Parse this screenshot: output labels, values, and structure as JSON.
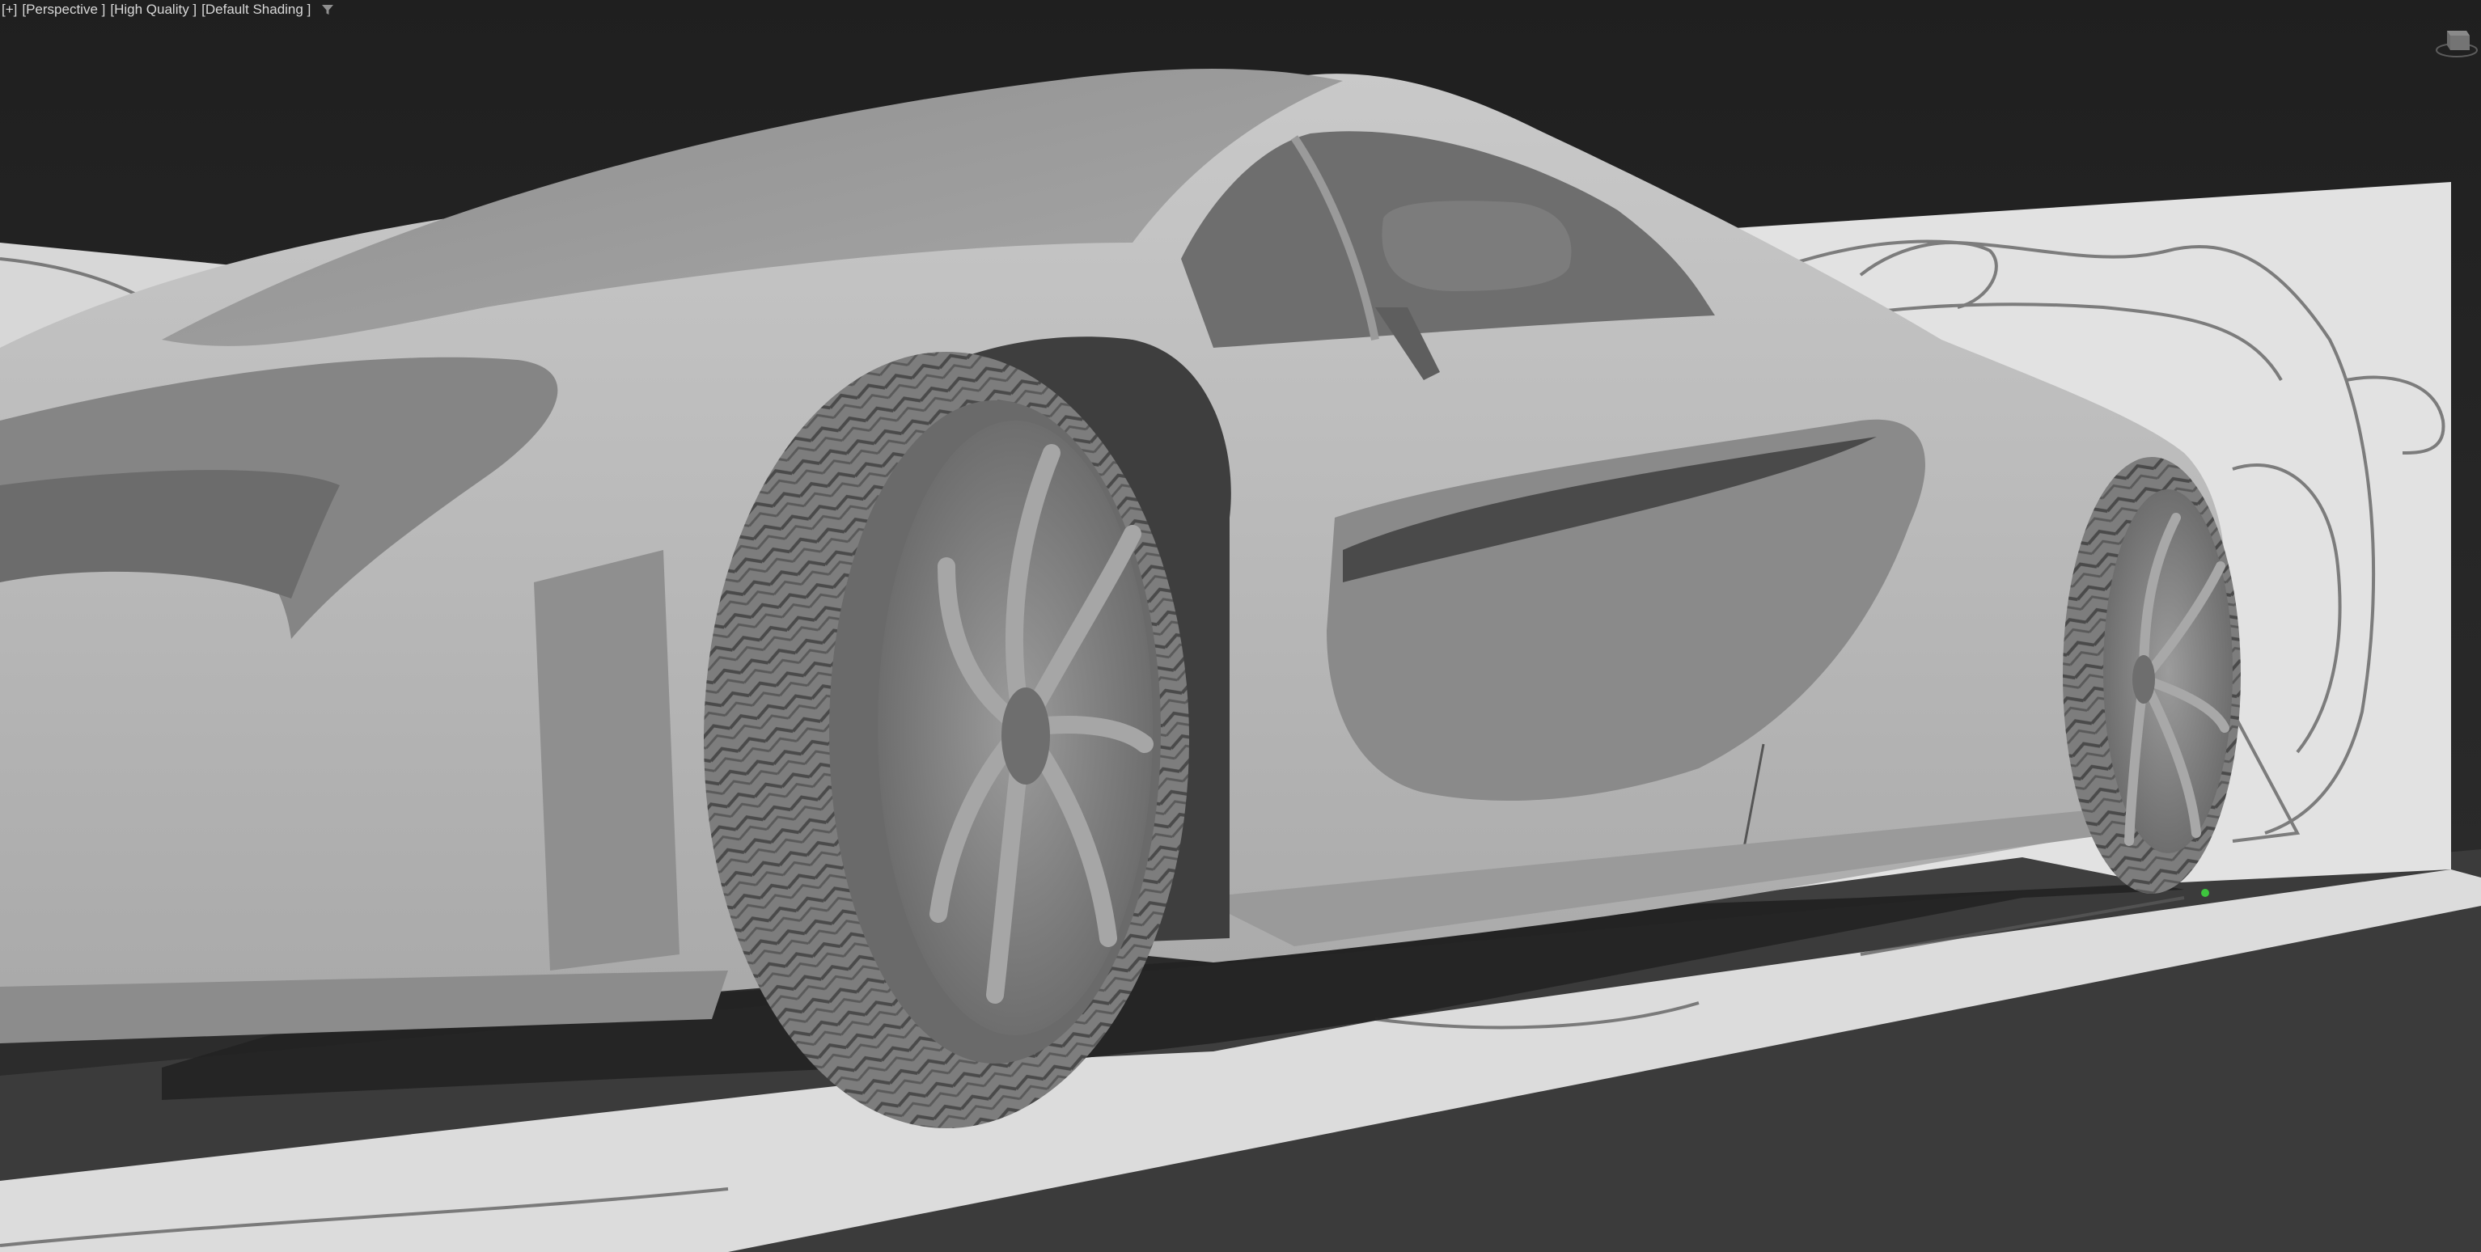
{
  "viewport": {
    "labels": {
      "plus": "[+]",
      "view": "[Perspective ]",
      "quality": "[High Quality ]",
      "shading": "[Default Shading ]"
    },
    "filter_icon": "funnel-icon",
    "viewcube_icon": "viewcube-icon",
    "scene": {
      "subject": "supercar-model",
      "shading_color": "#bdbdbd",
      "background_color": "#262626",
      "blueprint_plane_color": "#e2e2e2",
      "gizmo_color": "#3ec43e"
    }
  }
}
